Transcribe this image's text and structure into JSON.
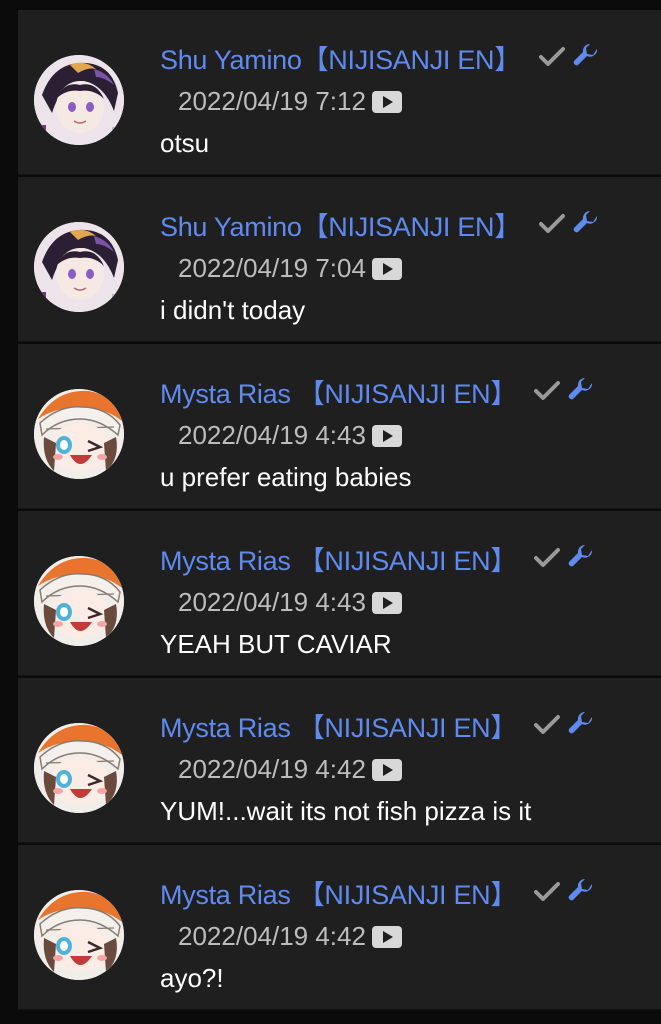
{
  "comments": [
    {
      "author": "Shu Yamino【NIJISANJI EN】",
      "avatar_icon": "shu-avatar-icon",
      "timestamp": "2022/04/19 7:12",
      "text": "otsu"
    },
    {
      "author": "Shu Yamino【NIJISANJI EN】",
      "avatar_icon": "shu-avatar-icon",
      "timestamp": "2022/04/19 7:04",
      "text": "i didn't today"
    },
    {
      "author": "Mysta Rias 【NIJISANJI EN】",
      "avatar_icon": "mysta-avatar-icon",
      "timestamp": "2022/04/19 4:43",
      "text": "u prefer eating babies"
    },
    {
      "author": "Mysta Rias 【NIJISANJI EN】",
      "avatar_icon": "mysta-avatar-icon",
      "timestamp": "2022/04/19 4:43",
      "text": "YEAH BUT CAVIAR"
    },
    {
      "author": "Mysta Rias 【NIJISANJI EN】",
      "avatar_icon": "mysta-avatar-icon",
      "timestamp": "2022/04/19 4:42",
      "text": "YUM!...wait its not fish pizza is it"
    },
    {
      "author": "Mysta Rias 【NIJISANJI EN】",
      "avatar_icon": "mysta-avatar-icon",
      "timestamp": "2022/04/19 4:42",
      "text": "ayo?!"
    }
  ],
  "badges": {
    "verified_icon": "checkmark-icon",
    "moderator_icon": "wrench-icon",
    "video_icon": "video-icon"
  },
  "colors": {
    "background": "#1f1f1f",
    "author": "#5f8af0",
    "timestamp": "#bdbdbd",
    "message": "#ffffff",
    "verified": "#9a9a9a",
    "moderator": "#5f8af0"
  }
}
